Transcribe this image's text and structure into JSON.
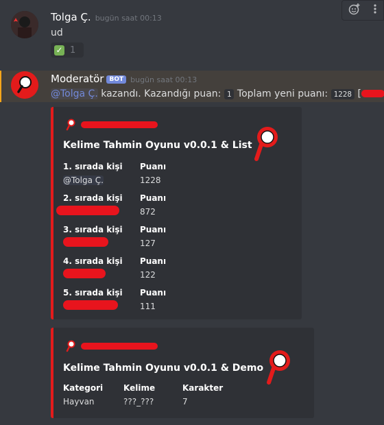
{
  "message1": {
    "username": "Tolga Ç.",
    "timestamp": "bugün saat 00:13",
    "text": "ud",
    "reaction": {
      "emoji": "✅",
      "count": "1"
    }
  },
  "toolbar": {
    "icons": [
      "add-reaction-icon",
      "more-icon"
    ]
  },
  "message2": {
    "username": "Moderatör",
    "bot_tag": "BOT",
    "timestamp": "bugün saat 00:13",
    "mention": "@Tolga Ç.",
    "text_part1": " kazandı. Kazandığı puan: ",
    "points": "1",
    "text_part2": " Toplam yeni puanı: ",
    "total": "1228",
    "bracket_open": "[",
    "bracket_close": "]"
  },
  "embed1": {
    "title": "Kelime Tahmin Oyunu v0.0.1 & List",
    "rows": [
      {
        "rank_label": "1. sırada kişi",
        "user": "@Tolga Ç.",
        "points_label": "Puanı",
        "points": "1228"
      },
      {
        "rank_label": "2. sırada kişi",
        "user": "",
        "points_label": "Puanı",
        "points": "872"
      },
      {
        "rank_label": "3. sırada kişi",
        "user": "",
        "points_label": "Puanı",
        "points": "127"
      },
      {
        "rank_label": "4. sırada kişi",
        "user": "",
        "points_label": "Puanı",
        "points": "122"
      },
      {
        "rank_label": "5. sırada kişi",
        "user": "",
        "points_label": "Puanı",
        "points": "111"
      }
    ]
  },
  "embed2": {
    "title": "Kelime Tahmin Oyunu v0.0.1 & Demo",
    "fields": [
      {
        "name": "Kategori",
        "value": "Hayvan"
      },
      {
        "name": "Kelime",
        "value": "???_???"
      },
      {
        "name": "Karakter",
        "value": "7"
      }
    ]
  },
  "colors": {
    "accent": "#e31b1b",
    "mention": "#7289da",
    "background": "#36393f",
    "embed": "#2f3136"
  }
}
